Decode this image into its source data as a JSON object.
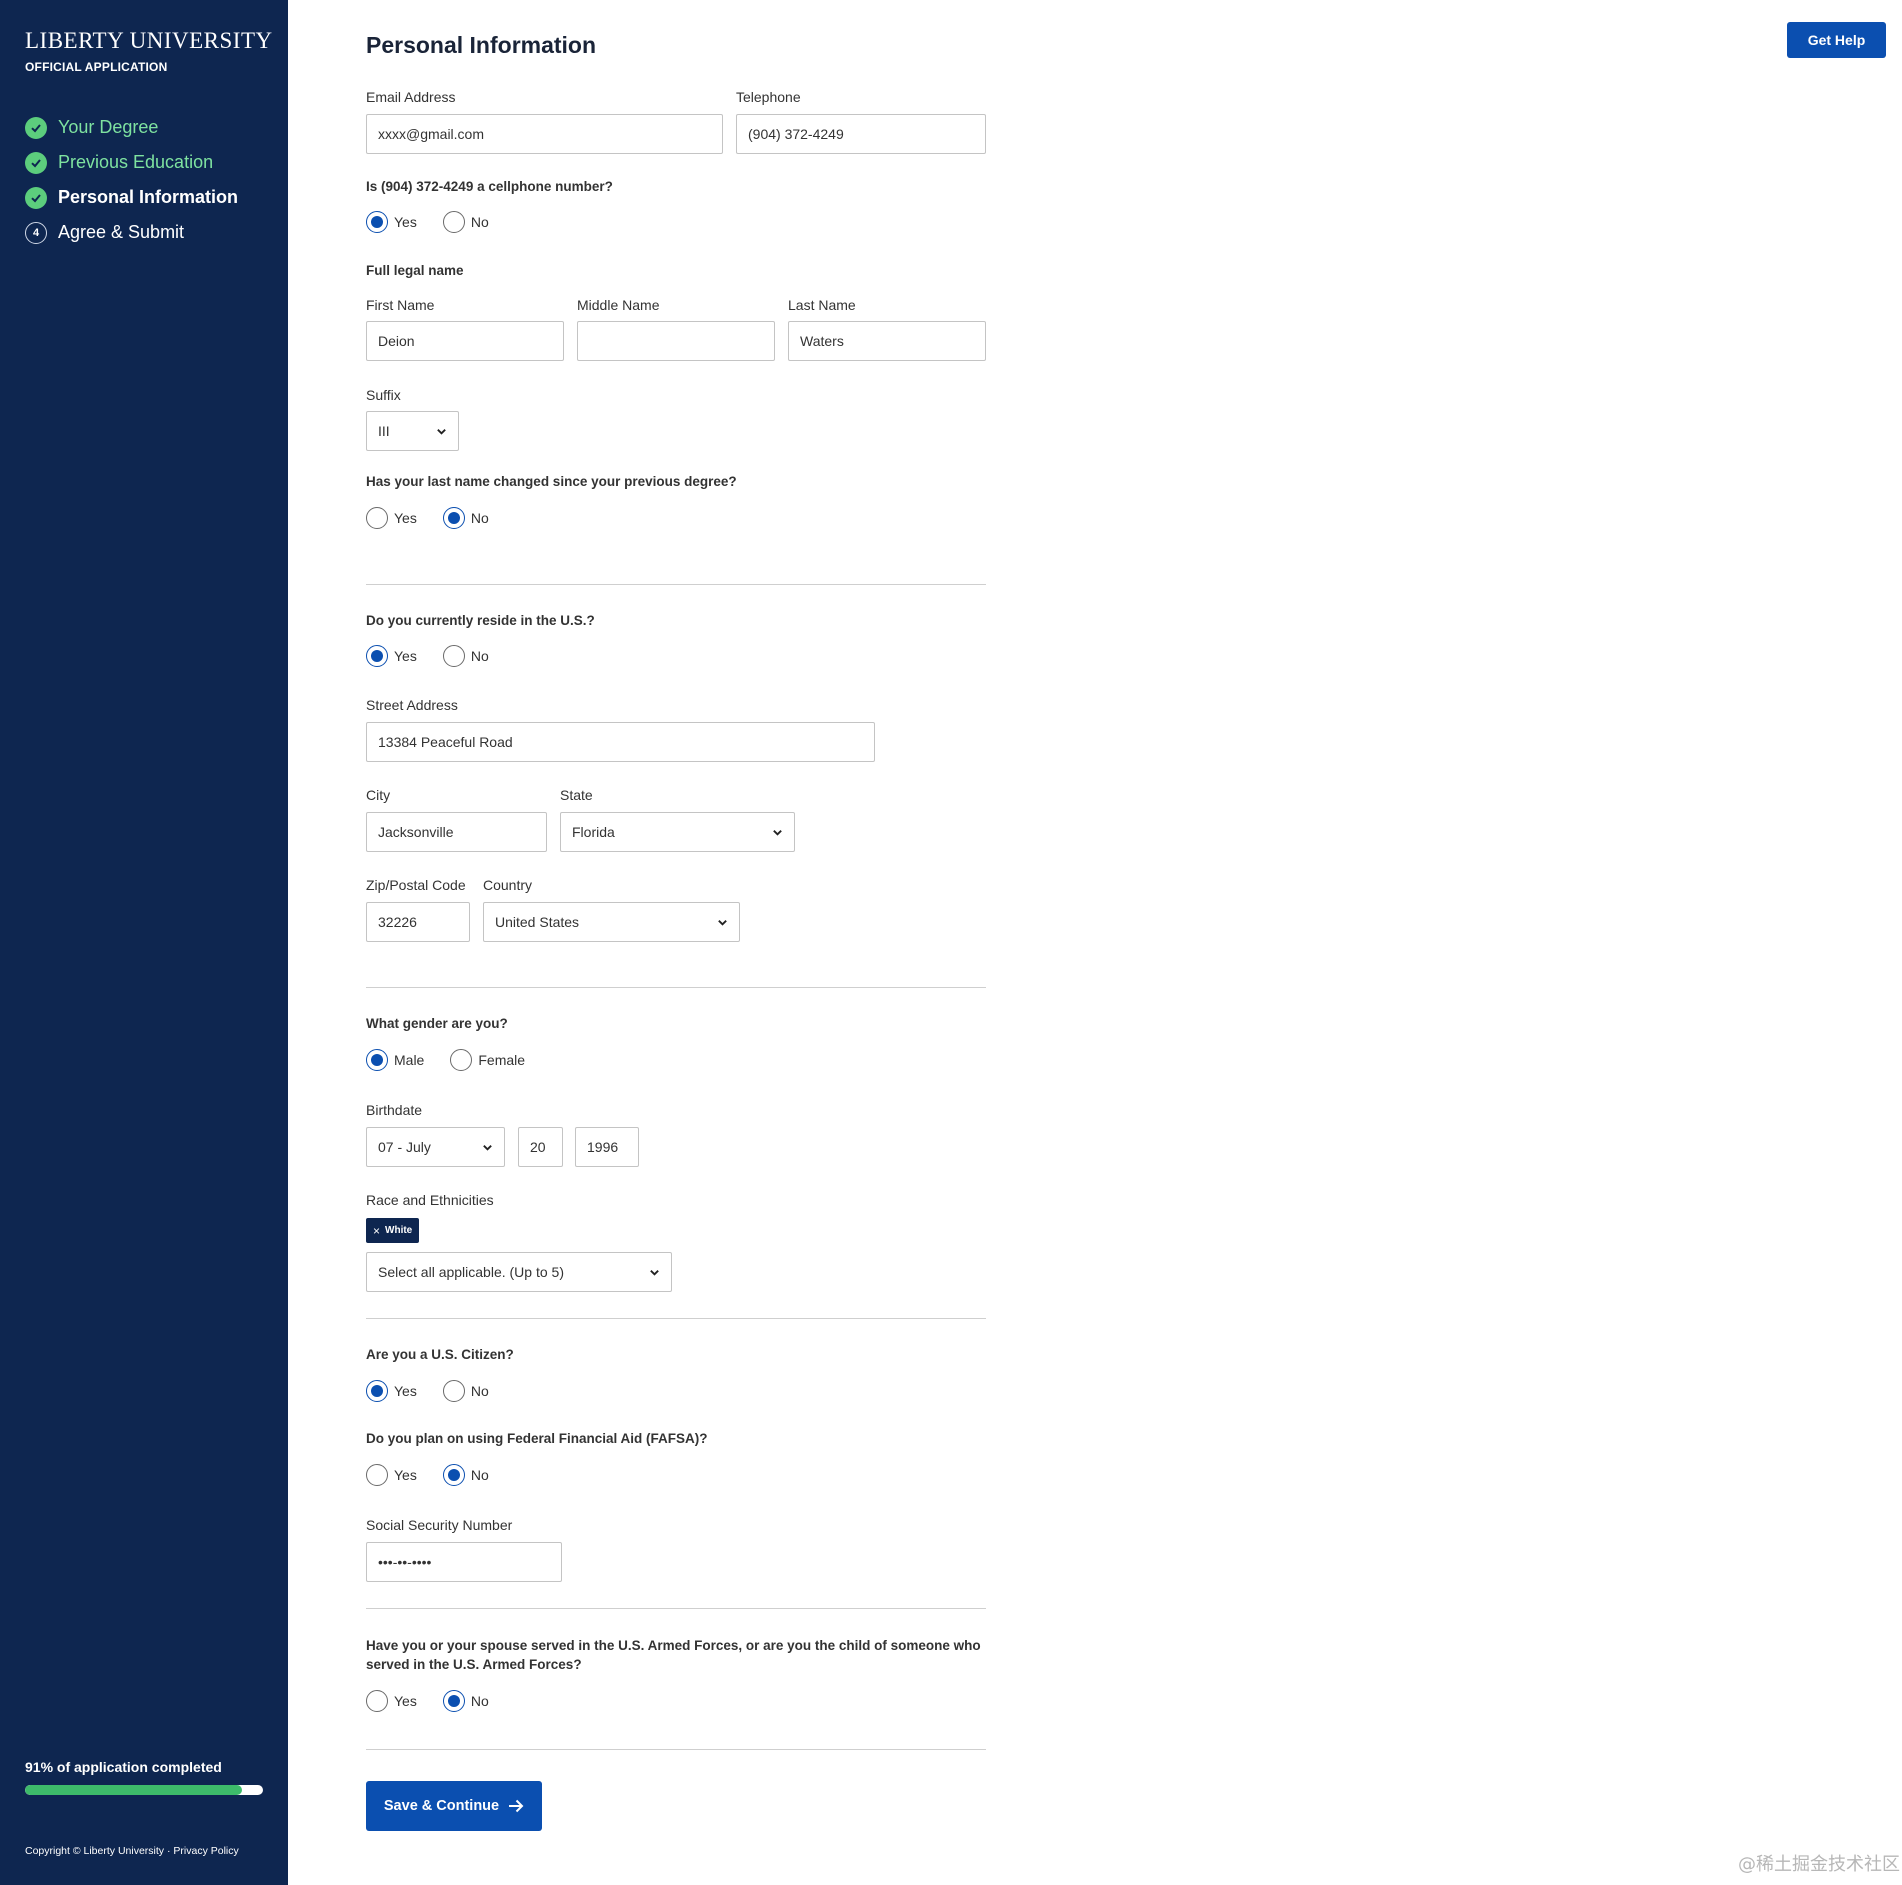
{
  "sidebar": {
    "brand_name": "LIBERTY UNIVERSITY",
    "brand_sub": "OFFICIAL APPLICATION",
    "steps": [
      {
        "label": "Your Degree",
        "state": "done"
      },
      {
        "label": "Previous Education",
        "state": "done"
      },
      {
        "label": "Personal Information",
        "state": "current"
      },
      {
        "label": "Agree & Submit",
        "state": "upcoming",
        "number": "4"
      }
    ],
    "progress_text": "91% of application completed",
    "progress_fraction": 0.91,
    "copyright": "Copyright © Liberty University",
    "separator": " · ",
    "privacy": "Privacy Policy"
  },
  "header": {
    "title": "Personal Information",
    "help_label": "Get Help"
  },
  "form": {
    "email": {
      "label": "Email Address",
      "value": "xxxx@gmail.com"
    },
    "telephone": {
      "label": "Telephone",
      "value": "(904) 372-4249"
    },
    "cellphone_q": {
      "question": "Is (904) 372-4249 a cellphone number?",
      "yes": "Yes",
      "no": "No",
      "selected": "yes"
    },
    "legal_name_heading": "Full legal name",
    "first_name": {
      "label": "First Name",
      "value": "Deion"
    },
    "middle_name": {
      "label": "Middle Name",
      "value": ""
    },
    "last_name": {
      "label": "Last Name",
      "value": "Waters"
    },
    "suffix": {
      "label": "Suffix",
      "value": "III"
    },
    "name_changed_q": {
      "question": "Has your last name changed since your previous degree?",
      "yes": "Yes",
      "no": "No",
      "selected": "no"
    },
    "reside_us_q": {
      "question": "Do you currently reside in the U.S.?",
      "yes": "Yes",
      "no": "No",
      "selected": "yes"
    },
    "street": {
      "label": "Street Address",
      "value": "13384 Peaceful Road"
    },
    "city": {
      "label": "City",
      "value": "Jacksonville"
    },
    "state": {
      "label": "State",
      "value": "Florida"
    },
    "zip": {
      "label": "Zip/Postal Code",
      "value": "32226"
    },
    "country": {
      "label": "Country",
      "value": "United States"
    },
    "gender_q": {
      "question": "What gender are you?",
      "male": "Male",
      "female": "Female",
      "selected": "male"
    },
    "birthdate": {
      "label": "Birthdate",
      "month": "07 - July",
      "day": "20",
      "year": "1996"
    },
    "race": {
      "label": "Race and Ethnicities",
      "tag": "White",
      "tag_remove": "×",
      "placeholder": "Select all applicable. (Up to 5)"
    },
    "citizen_q": {
      "question": "Are you a U.S. Citizen?",
      "yes": "Yes",
      "no": "No",
      "selected": "yes"
    },
    "fafsa_q": {
      "question": "Do you plan on using Federal Financial Aid (FAFSA)?",
      "yes": "Yes",
      "no": "No",
      "selected": "no"
    },
    "ssn": {
      "label": "Social Security Number",
      "value": "•••-••-••••"
    },
    "military_q": {
      "question": "Have you or your spouse served in the U.S. Armed Forces, or are you the child of someone who served in the U.S. Armed Forces?",
      "yes": "Yes",
      "no": "No",
      "selected": "no"
    },
    "save_label": "Save & Continue"
  },
  "watermark": "@稀土掘金技术社区",
  "colors": {
    "sidebar_bg": "#0e2650",
    "accent": "#0b4fb0",
    "success": "#3dbb6a"
  }
}
